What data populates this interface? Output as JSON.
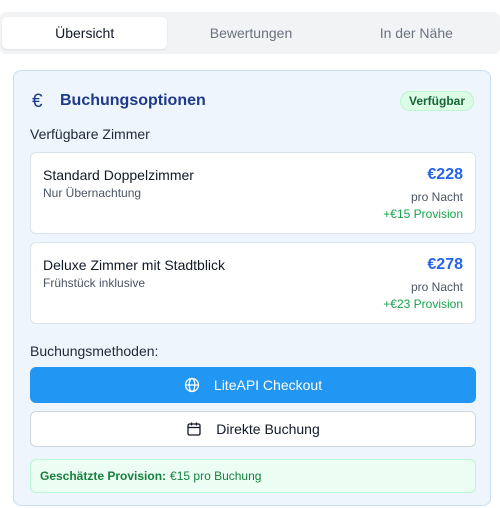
{
  "tabs": [
    {
      "label": "Übersicht",
      "active": true
    },
    {
      "label": "Bewertungen",
      "active": false
    },
    {
      "label": "In der Nähe",
      "active": false
    }
  ],
  "booking": {
    "icon": "euro-icon",
    "title": "Buchungsoptionen",
    "status_badge": "Verfügbar",
    "rooms_label": "Verfügbare Zimmer",
    "rooms": [
      {
        "name": "Standard Doppelzimmer",
        "description": "Nur Übernachtung",
        "price": "€228",
        "unit": "pro Nacht",
        "commission": "+€15 Provision"
      },
      {
        "name": "Deluxe Zimmer mit Stadtblick",
        "description": "Frühstück inklusive",
        "price": "€278",
        "unit": "pro Nacht",
        "commission": "+€23 Provision"
      }
    ],
    "methods_label": "Buchungsmethoden:",
    "methods": [
      {
        "label": "LiteAPI Checkout",
        "icon": "globe-icon"
      },
      {
        "label": "Direkte Buchung",
        "icon": "calendar-icon"
      }
    ],
    "provision_label": "Geschätzte Provision:",
    "provision_value": "€15 pro Buchung"
  },
  "colors": {
    "accent": "#1e3a8a",
    "primary_button": "#2196f3",
    "price": "#2563eb",
    "success": "#16a34a"
  }
}
